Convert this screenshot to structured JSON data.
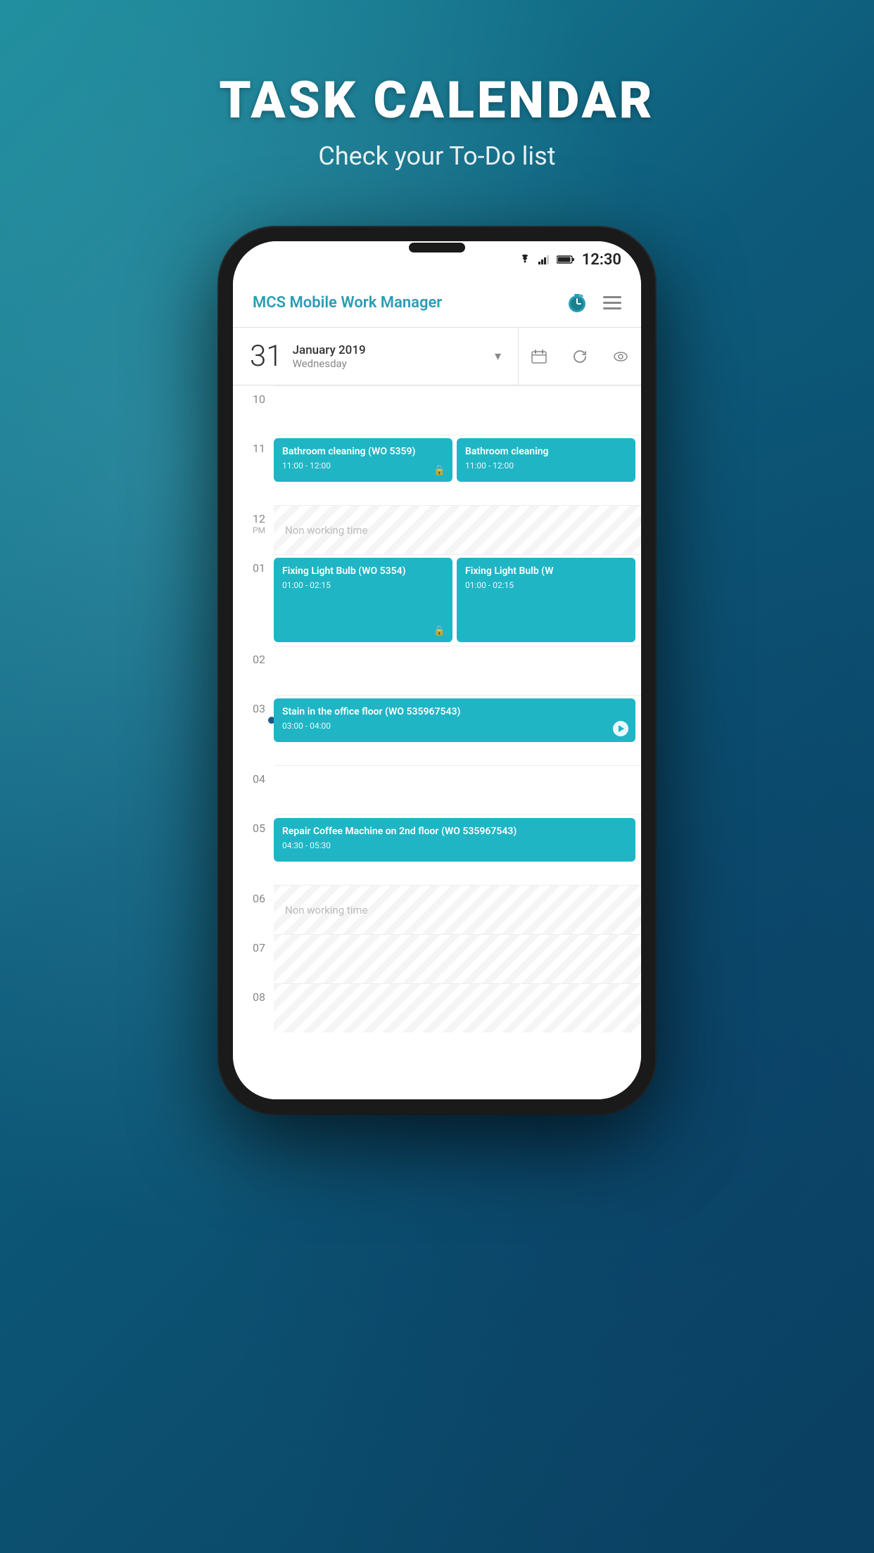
{
  "page": {
    "title": "TASK CALENDAR",
    "subtitle": "Check your To-Do list"
  },
  "status_bar": {
    "time": "12:30"
  },
  "app_header": {
    "title": "MCS Mobile Work Manager"
  },
  "date_bar": {
    "day": "31",
    "month_year": "January 2019",
    "weekday": "Wednesday"
  },
  "time_slots": [
    {
      "hour": "10",
      "period": "",
      "type": "empty"
    },
    {
      "hour": "11",
      "period": "",
      "type": "events",
      "events": [
        {
          "id": "ev1",
          "title": "Bathroom cleaning (WO 5359)",
          "time": "11:00 - 12:00",
          "locked": true
        },
        {
          "id": "ev2",
          "title": "Bathroom cleaning",
          "time": "11:00 - 12:00",
          "locked": false
        }
      ]
    },
    {
      "hour": "12",
      "period": "PM",
      "type": "non-working",
      "label": "Non working time"
    },
    {
      "hour": "01",
      "period": "",
      "type": "events",
      "events": [
        {
          "id": "ev3",
          "title": "Fixing Light Bulb (WO 5354)",
          "time": "01:00 - 02:15",
          "locked": true
        },
        {
          "id": "ev4",
          "title": "Fixing Light Bulb (W",
          "time": "01:00 - 02:15",
          "locked": false
        }
      ]
    },
    {
      "hour": "02",
      "period": "",
      "type": "empty"
    },
    {
      "hour": "03",
      "period": "",
      "type": "events-wide",
      "events": [
        {
          "id": "ev5",
          "title": "Stain in the office floor (WO 535967543)",
          "time": "03:00 - 04:00",
          "play": true,
          "current": true
        }
      ]
    },
    {
      "hour": "04",
      "period": "",
      "type": "empty"
    },
    {
      "hour": "05",
      "period": "",
      "type": "events-wide",
      "events": [
        {
          "id": "ev6",
          "title": "Repair Coffee Machine on 2nd floor (WO 535967543)",
          "time": "04:30 - 05:30",
          "play": false
        }
      ]
    },
    {
      "hour": "06",
      "period": "",
      "type": "non-working",
      "label": "Non working time"
    },
    {
      "hour": "07",
      "period": "",
      "type": "non-working-cont",
      "label": ""
    },
    {
      "hour": "08",
      "period": "",
      "type": "non-working-cont",
      "label": ""
    }
  ]
}
